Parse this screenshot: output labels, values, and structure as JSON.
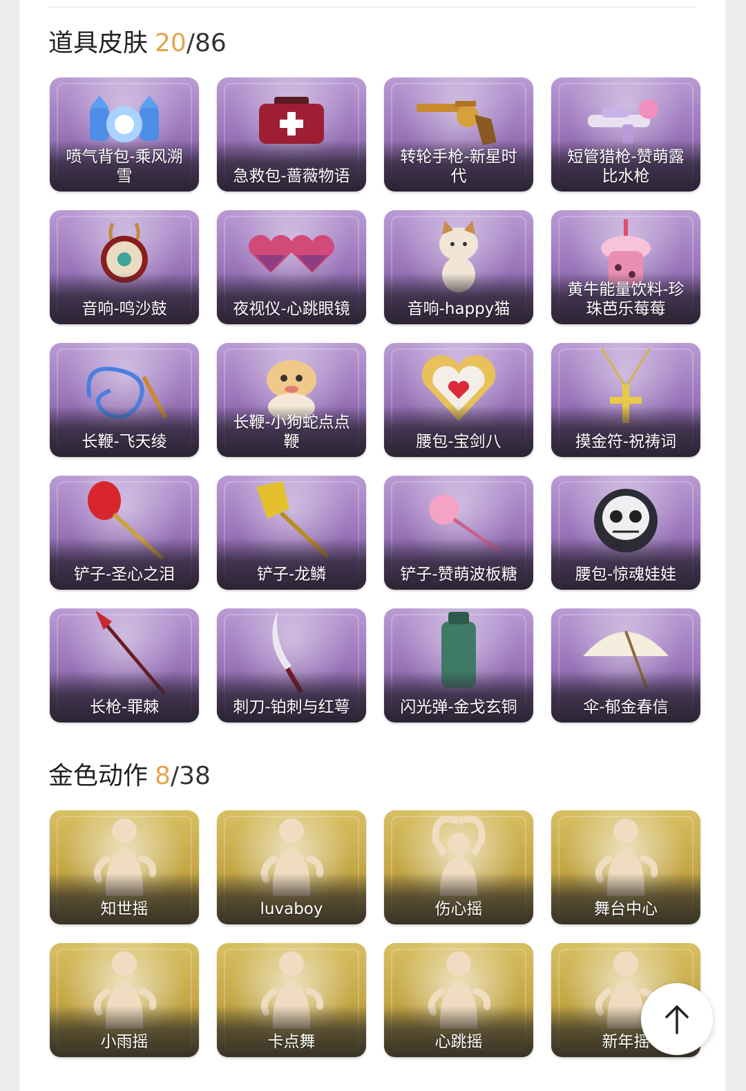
{
  "sections": [
    {
      "title": "道具皮肤",
      "owned": "20",
      "total": "86",
      "theme": "purple",
      "items": [
        {
          "name": "喷气背包-乘风溯雪",
          "icon": "jetpack-icon"
        },
        {
          "name": "急救包-蔷薇物语",
          "icon": "medkit-icon"
        },
        {
          "name": "转轮手枪-新星时代",
          "icon": "revolver-icon"
        },
        {
          "name": "短管猎枪-赞萌露比水枪",
          "icon": "water-gun-icon"
        },
        {
          "name": "音响-鸣沙鼓",
          "icon": "drum-icon"
        },
        {
          "name": "夜视仪-心跳眼镜",
          "icon": "heart-glasses-icon"
        },
        {
          "name": "音响-happy猫",
          "icon": "cat-icon"
        },
        {
          "name": "黄牛能量饮料-珍珠芭乐莓莓",
          "icon": "drink-icon"
        },
        {
          "name": "长鞭-飞天绫",
          "icon": "ribbon-whip-icon"
        },
        {
          "name": "长鞭-小狗蛇点点鞭",
          "icon": "snake-icon"
        },
        {
          "name": "腰包-宝剑八",
          "icon": "heart-pouch-icon"
        },
        {
          "name": "摸金符-祝祷词",
          "icon": "cross-charm-icon"
        },
        {
          "name": "铲子-圣心之泪",
          "icon": "red-shovel-icon"
        },
        {
          "name": "铲子-龙鳞",
          "icon": "gold-shovel-icon"
        },
        {
          "name": "铲子-赞萌波板糖",
          "icon": "lollipop-shovel-icon"
        },
        {
          "name": "腰包-惊魂娃娃",
          "icon": "skull-pouch-icon"
        },
        {
          "name": "长枪-罪棘",
          "icon": "spear-icon"
        },
        {
          "name": "刺刀-铂刺与红萼",
          "icon": "bayonet-icon"
        },
        {
          "name": "闪光弹-金戈玄铜",
          "icon": "grenade-icon"
        },
        {
          "name": "伞-郁金春信",
          "icon": "umbrella-icon"
        }
      ]
    },
    {
      "title": "金色动作",
      "owned": "8",
      "total": "38",
      "theme": "gold",
      "items": [
        {
          "name": "知世摇",
          "icon": "emote-figure-icon"
        },
        {
          "name": "luvaboy",
          "icon": "emote-figure-icon"
        },
        {
          "name": "伤心摇",
          "icon": "emote-heart-hands-icon"
        },
        {
          "name": "舞台中心",
          "icon": "emote-figure-icon"
        },
        {
          "name": "小雨摇",
          "icon": "emote-figure-icon"
        },
        {
          "name": "卡点舞",
          "icon": "emote-figure-icon"
        },
        {
          "name": "心跳摇",
          "icon": "emote-figure-icon"
        },
        {
          "name": "新年摇",
          "icon": "emote-figure-icon"
        }
      ]
    }
  ],
  "scroll_top": {
    "icon": "arrow-up-icon"
  }
}
